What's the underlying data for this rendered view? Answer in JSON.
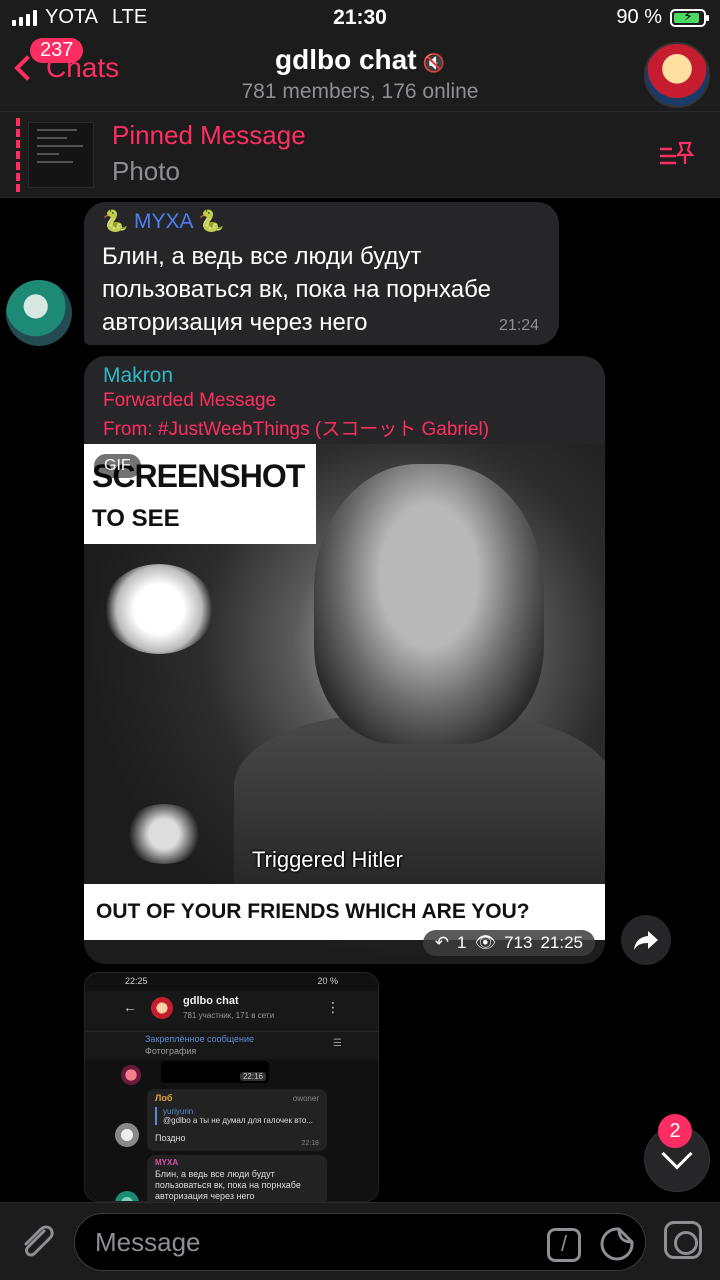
{
  "status_bar": {
    "carrier": "YOTA",
    "network": "LTE",
    "time": "21:30",
    "battery_percent": "90 %",
    "battery_level": 0.9
  },
  "header": {
    "back_label": "Chats",
    "unread_count": "237",
    "title": "gdlbo chat",
    "subtitle": "781 members, 176 online",
    "muted_icon": "mute-icon"
  },
  "pinned": {
    "title": "Pinned Message",
    "subtitle": "Photo"
  },
  "messages": [
    {
      "author": "🐍 MYXA 🐍",
      "text": "Блин, а ведь все люди будут пользоваться вк, пока на порнхабе авторизация через него",
      "time": "21:24"
    },
    {
      "author": "Makron",
      "forwarded_label": "Forwarded Message",
      "from": "From: #JustWeebThings (スコーット Gabriel)",
      "media_badge": "GIF",
      "caption_top_1": "SCREENSHOT",
      "caption_top_2": "TO SEE",
      "caption_middle": "Triggered Hitler",
      "caption_bottom": "OUT OF YOUR FRIENDS WHICH ARE YOU?",
      "replies": "1",
      "views": "713",
      "time": "21:25"
    },
    {
      "screenshot": {
        "time": "22:25",
        "battery": "20 %",
        "title": "gdlbo chat",
        "subtitle": "781 участник, 171 в сети",
        "pinned_title": "Закреплённое сообщение",
        "pinned_sub": "Фотография",
        "video_time": "22:16",
        "msg1_author": "Лоб",
        "msg1_role": "owoner",
        "msg1_quote_name": "yuriyurin",
        "msg1_quote_text": "@gdlbo а ты не думал для галочек вто...",
        "msg1_text": "Поздно",
        "msg1_time": "22:18",
        "msg2_author": "MYXA",
        "msg2_text": "Блин, а ведь все люди будут пользоваться вк, пока на порнхабе авторизация через него"
      }
    }
  ],
  "scroll_down_badge": "2",
  "composer": {
    "placeholder": "Message",
    "command_glyph": "/"
  }
}
